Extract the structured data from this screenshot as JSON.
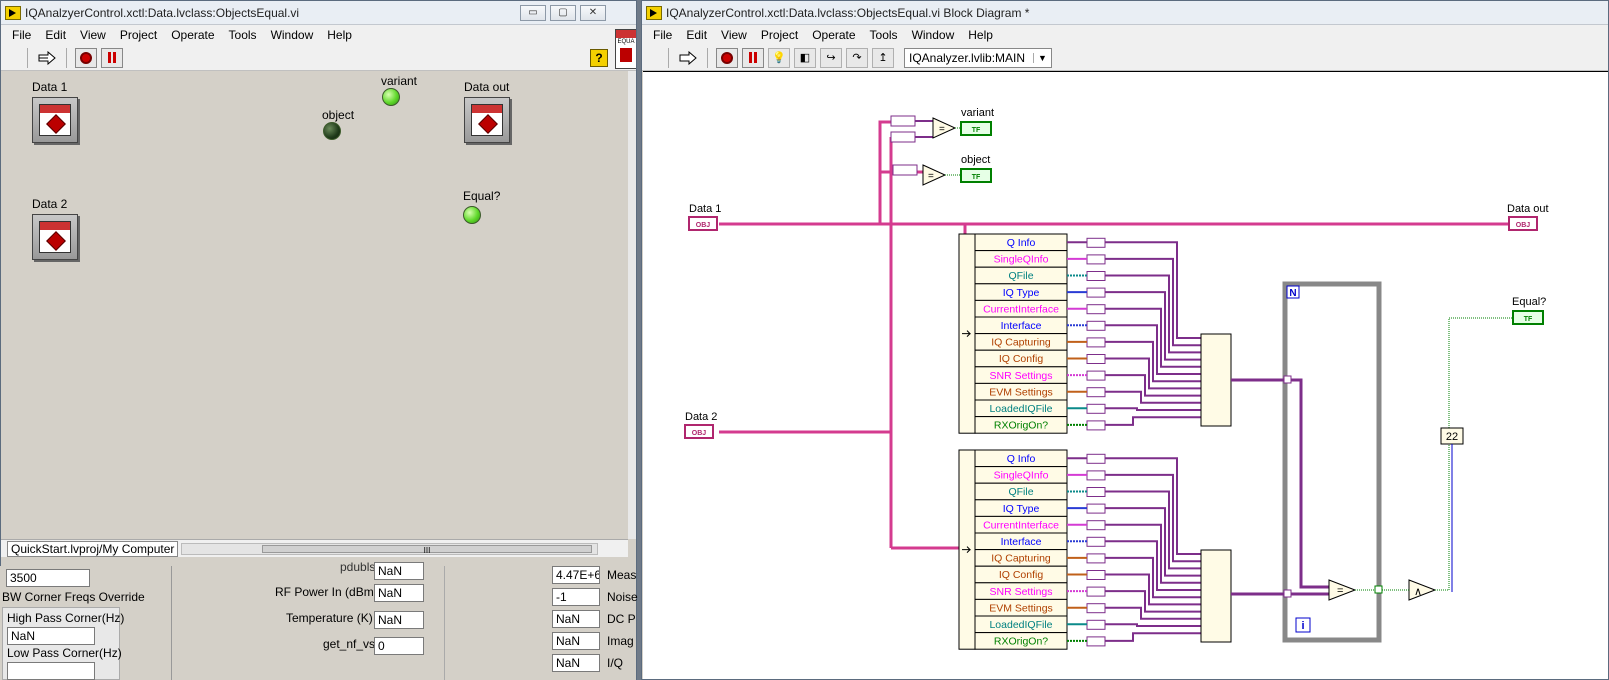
{
  "front_panel": {
    "title": "IQAnalzyerControl.xctl:Data.lvclass:ObjectsEqual.vi",
    "menu": [
      "File",
      "Edit",
      "View",
      "Project",
      "Operate",
      "Tools",
      "Window",
      "Help"
    ],
    "controls": {
      "data1": "Data 1",
      "data2": "Data 2",
      "data_out": "Data out",
      "object": "object",
      "variant": "variant",
      "equal": "Equal?"
    },
    "statusbar_path": "QuickStart.lvproj/My Computer",
    "scroll_thumb": "III",
    "win_buttons": [
      "▭",
      "▢",
      "✕"
    ]
  },
  "lower_panel": {
    "left_value": "3500",
    "bw_label": "BW Corner Freqs Override",
    "high_pass_label": "High Pass Corner(Hz)",
    "high_pass_value": "NaN",
    "low_pass_label": "Low Pass Corner(Hz)",
    "partial_label": "pdubls",
    "rows": [
      {
        "label": "RF Power In (dBm)",
        "value": "NaN"
      },
      {
        "label": "Temperature (K)",
        "value": "NaN"
      },
      {
        "label": "get_nf_vs",
        "value": "0"
      }
    ],
    "first_value": "NaN",
    "right_values": [
      "4.47E+6",
      "-1",
      "NaN",
      "NaN",
      "NaN"
    ],
    "right_labels": [
      "Meas",
      "Noise",
      "DC P",
      "Imag",
      "I/Q"
    ]
  },
  "block_diagram": {
    "title": "IQAnalyzerControl.xctl:Data.lvclass:ObjectsEqual.vi Block Diagram *",
    "menu": [
      "File",
      "Edit",
      "View",
      "Project",
      "Operate",
      "Tools",
      "Window",
      "Help"
    ],
    "context": "IQAnalyzer.lvlib:MAIN",
    "terminals": {
      "data1": "Data 1",
      "data2": "Data 2",
      "data_out": "Data out",
      "variant": "variant",
      "object": "object",
      "equal": "Equal?"
    },
    "obj_tag": "OBJ",
    "tf_tag": "TF",
    "unbundle_items": [
      "Q Info",
      "SingleQInfo",
      "QFile",
      "IQ Type",
      "CurrentInterface",
      "Interface",
      "IQ Capturing",
      "IQ Config",
      "SNR Settings",
      "EVM Settings",
      "LoadedIQFile",
      "RXOrigOn?"
    ],
    "loop_count": "N",
    "loop_index": "i",
    "constant": "22",
    "eq_symbol": "=",
    "and_symbol": "∧"
  }
}
